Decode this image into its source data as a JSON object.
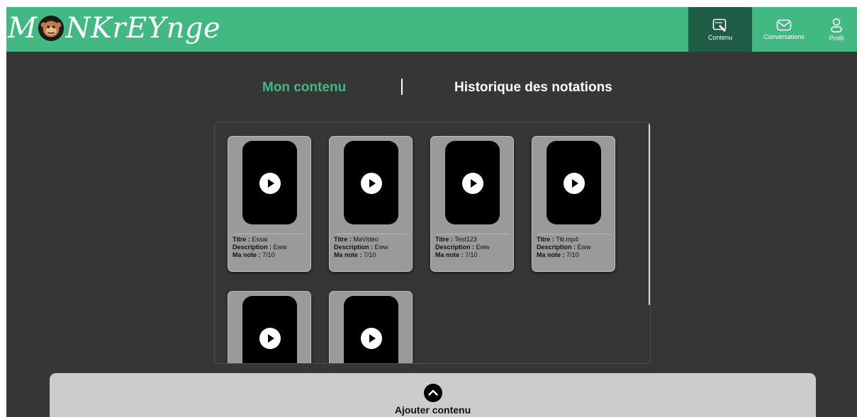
{
  "brand": {
    "name_part1": "M",
    "name_part2": "NKrEYnge",
    "primary_color": "#42b883",
    "active_nav_color": "#1f5c45",
    "background_color": "#363636"
  },
  "nav": {
    "items": [
      {
        "label": "Contenu",
        "icon": "content-edit-icon",
        "active": true
      },
      {
        "label": "Conversations",
        "icon": "mail-icon",
        "active": false
      },
      {
        "label": "Profil",
        "icon": "user-icon",
        "active": false
      }
    ]
  },
  "tabs": {
    "mine": "Mon contenu",
    "history": "Historique des notations",
    "active": "mine"
  },
  "labels": {
    "title": "Titre :",
    "description": "Description :",
    "rating": "Ma note :"
  },
  "videos": [
    {
      "title": "Essai",
      "description": "Eww",
      "rating": "7/10"
    },
    {
      "title": "MaVideo",
      "description": "Eww",
      "rating": "7/10"
    },
    {
      "title": "Test123",
      "description": "Eww",
      "rating": "7/10"
    },
    {
      "title": "Titi.mp4",
      "description": "Eww",
      "rating": "7/10"
    },
    {
      "title": "",
      "description": "",
      "rating": ""
    },
    {
      "title": "",
      "description": "",
      "rating": ""
    }
  ],
  "add": {
    "label": "Ajouter contenu",
    "icon": "chevron-up-icon"
  }
}
